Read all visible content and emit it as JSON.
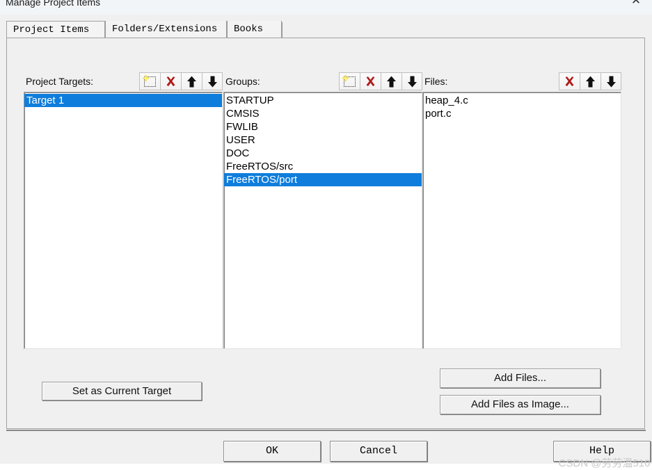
{
  "window": {
    "title": "Manage Project Items",
    "close_label": "✕"
  },
  "tabs": [
    {
      "label": "Project Items",
      "active": true
    },
    {
      "label": "Folders/Extensions",
      "active": false
    },
    {
      "label": "Books",
      "active": false
    }
  ],
  "colors": {
    "selection_blue": "#0f7ddc",
    "selection_text": "#ffffff",
    "dialog_face": "#f0f0f0",
    "delete_icon_red": "#b01a18",
    "new_icon_yellow": "#ffd400",
    "watermark_gray": "#c9c9c9"
  },
  "panels": {
    "targets": {
      "label": "Project Targets:",
      "toolbar": [
        {
          "name": "new-item-icon",
          "title": "New (Insert)"
        },
        {
          "name": "delete-icon",
          "title": "Remove"
        },
        {
          "name": "move-up-icon",
          "title": "Move Up"
        },
        {
          "name": "move-down-icon",
          "title": "Move Down"
        }
      ],
      "items": [
        {
          "label": "Target 1",
          "selected": true
        }
      ]
    },
    "groups": {
      "label": "Groups:",
      "toolbar": [
        {
          "name": "new-item-icon",
          "title": "New (Insert)"
        },
        {
          "name": "delete-icon",
          "title": "Remove"
        },
        {
          "name": "move-up-icon",
          "title": "Move Up"
        },
        {
          "name": "move-down-icon",
          "title": "Move Down"
        }
      ],
      "items": [
        {
          "label": "STARTUP",
          "selected": false
        },
        {
          "label": "CMSIS",
          "selected": false
        },
        {
          "label": "FWLIB",
          "selected": false
        },
        {
          "label": "USER",
          "selected": false
        },
        {
          "label": "DOC",
          "selected": false
        },
        {
          "label": "FreeRTOS/src",
          "selected": false
        },
        {
          "label": "FreeRTOS/port",
          "selected": true
        }
      ]
    },
    "files": {
      "label": "Files:",
      "toolbar": [
        {
          "name": "delete-icon",
          "title": "Remove"
        },
        {
          "name": "move-up-icon",
          "title": "Move Up"
        },
        {
          "name": "move-down-icon",
          "title": "Move Down"
        }
      ],
      "items": [
        {
          "label": "heap_4.c",
          "selected": false
        },
        {
          "label": "port.c",
          "selected": false
        }
      ]
    }
  },
  "buttons": {
    "set_as_current_target": "Set as Current Target",
    "add_files": "Add Files...",
    "add_files_as_image": "Add Files as Image...",
    "ok": "OK",
    "cancel": "Cancel",
    "help": "Help"
  },
  "watermark": {
    "text": "CSDN @劳劳温510"
  }
}
